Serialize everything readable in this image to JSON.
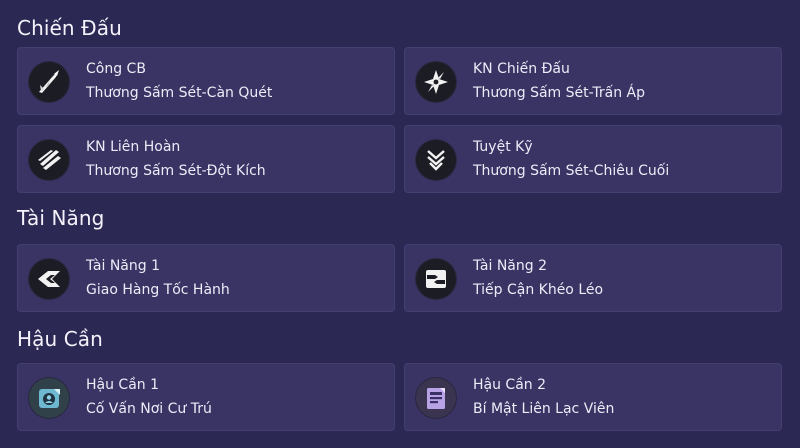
{
  "sections": [
    {
      "title": "Chiến Đấu",
      "cards": [
        {
          "label": "Công CB",
          "value": "Thương Sấm Sét-Càn Quét",
          "icon": "spear-slash-icon"
        },
        {
          "label": "KN Chiến Đấu",
          "value": "Thương Sấm Sét-Trấn Áp",
          "icon": "shuriken-icon"
        },
        {
          "label": "KN Liên Hoàn",
          "value": "Thương Sấm Sét-Đột Kích",
          "icon": "triple-slash-icon"
        },
        {
          "label": "Tuyệt Kỹ",
          "value": "Thương Sấm Sét-Chiêu Cuối",
          "icon": "chevron-stack-icon"
        }
      ]
    },
    {
      "title": "Tài Năng",
      "cards": [
        {
          "label": "Tài Năng 1",
          "value": "Giao Hàng Tốc Hành",
          "icon": "express-arrow-icon"
        },
        {
          "label": "Tài Năng 2",
          "value": "Tiếp Cận Khéo Léo",
          "icon": "stacked-arrows-icon"
        }
      ]
    },
    {
      "title": "Hậu Cần",
      "cards": [
        {
          "label": "Hậu Cần 1",
          "value": "Cố Vấn Nơi Cư Trú",
          "icon": "advisor-badge-icon"
        },
        {
          "label": "Hậu Cần 2",
          "value": "Bí Mật Liên Lạc Viên",
          "icon": "secret-document-icon"
        }
      ]
    }
  ]
}
